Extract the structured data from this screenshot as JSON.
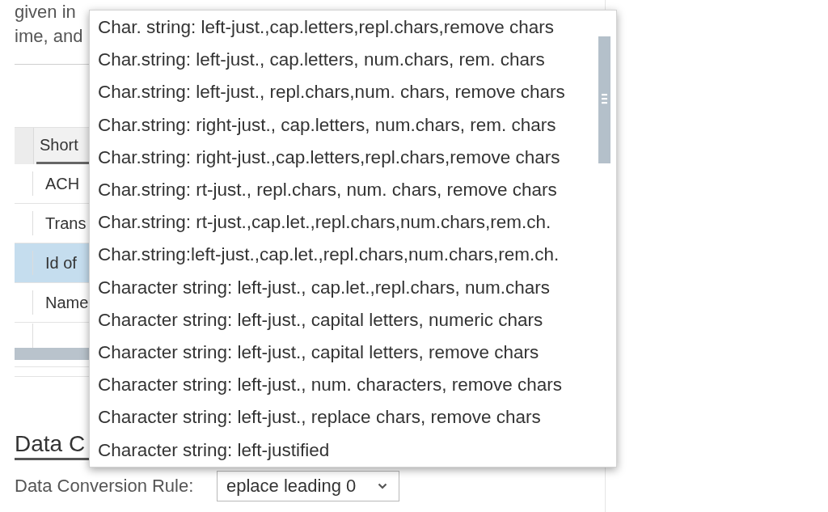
{
  "description": {
    "lines": [
      "given in",
      "ime, and"
    ]
  },
  "table": {
    "columns": [
      {
        "label": "Short"
      }
    ],
    "rows": [
      {
        "cells": [
          "ACH"
        ],
        "selected": false
      },
      {
        "cells": [
          "Trans"
        ],
        "selected": false
      },
      {
        "cells": [
          "Id of"
        ],
        "selected": true
      },
      {
        "cells": [
          "Name"
        ],
        "selected": false
      }
    ]
  },
  "section": {
    "title": "Data C"
  },
  "conversion_rule": {
    "label": "Data Conversion Rule:",
    "value": "eplace leading 0",
    "expanded": true
  },
  "dropdown_list": {
    "items": [
      {
        "label": "Char. string: left-just.,cap.letters,repl.chars,remove chars",
        "selected": false
      },
      {
        "label": "Char.string: left-just., cap.letters, num.chars, rem. chars",
        "selected": false
      },
      {
        "label": "Char.string: left-just., repl.chars,num. chars, remove chars",
        "selected": false
      },
      {
        "label": "Char.string: right-just., cap.letters, num.chars, rem. chars",
        "selected": false
      },
      {
        "label": "Char.string: right-just.,cap.letters,repl.chars,remove chars",
        "selected": false
      },
      {
        "label": "Char.string: rt-just., repl.chars, num. chars, remove chars",
        "selected": false
      },
      {
        "label": "Char.string: rt-just.,cap.let.,repl.chars,num.chars,rem.ch.",
        "selected": false
      },
      {
        "label": "Char.string:left-just.,cap.let.,repl.chars,num.chars,rem.ch.",
        "selected": false
      },
      {
        "label": "Character string: left-just., cap.let.,repl.chars, num.chars",
        "selected": false
      },
      {
        "label": "Character string: left-just., capital letters, numeric chars",
        "selected": false
      },
      {
        "label": "Character string: left-just., capital letters, remove chars",
        "selected": false
      },
      {
        "label": "Character string: left-just., num. characters, remove chars",
        "selected": false
      },
      {
        "label": "Character string: left-just., replace chars, remove chars",
        "selected": false
      },
      {
        "label": "Character string: left-justified",
        "selected": false
      }
    ]
  }
}
